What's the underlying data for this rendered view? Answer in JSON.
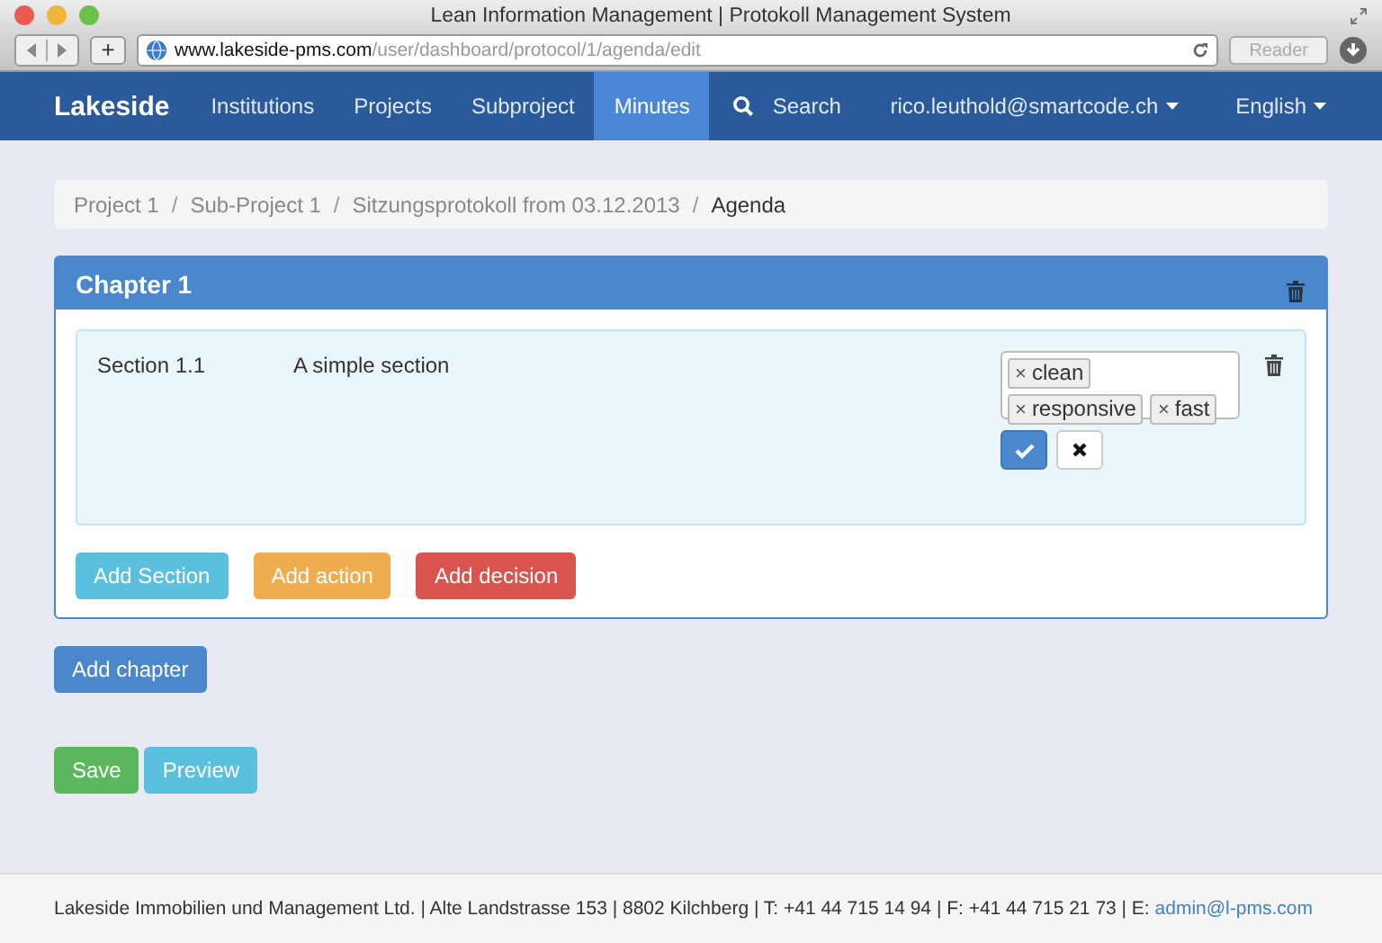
{
  "window": {
    "title": "Lean Information Management | Protokoll Management System"
  },
  "browser": {
    "url_host": "www.lakeside-pms.com",
    "url_path": "/user/dashboard/protocol/1/agenda/edit",
    "reader": "Reader",
    "new_tab": "+"
  },
  "navbar": {
    "brand": "Lakeside",
    "items": [
      {
        "label": "Institutions",
        "selected": false
      },
      {
        "label": "Projects",
        "selected": false
      },
      {
        "label": "Subproject",
        "selected": false
      },
      {
        "label": "Minutes",
        "selected": true
      }
    ],
    "search": "Search",
    "user": "rico.leuthold@smartcode.ch",
    "language": "English"
  },
  "breadcrumb_separator": "/",
  "breadcrumb": [
    {
      "label": "Project 1",
      "selected": false
    },
    {
      "label": "Sub-Project 1",
      "selected": false
    },
    {
      "label": "Sitzungsprotokoll from 03.12.2013",
      "selected": false
    },
    {
      "label": "Agenda",
      "selected": true
    }
  ],
  "chapter": {
    "title": "Chapter 1",
    "section": {
      "number": "Section 1.1",
      "title": "A simple section",
      "tags": [
        "clean",
        "responsive",
        "fast"
      ],
      "tag_remove": "×"
    },
    "buttons": [
      {
        "label": "Add Section",
        "kind": "info"
      },
      {
        "label": "Add action",
        "kind": "warning"
      },
      {
        "label": "Add decision",
        "kind": "danger"
      }
    ]
  },
  "add_chapter": {
    "label": "Add chapter",
    "kind": "primary"
  },
  "actions": [
    {
      "label": "Save",
      "kind": "success"
    },
    {
      "label": "Preview",
      "kind": "info"
    }
  ],
  "footer": {
    "text": "Lakeside Immobilien und Management Ltd. | Alte Landstrasse 153 | 8802 Kilchberg | T: +41 44 715 14 94 | F: +41 44 715 21 73 | E: ",
    "link": "admin@l-pms.com"
  }
}
